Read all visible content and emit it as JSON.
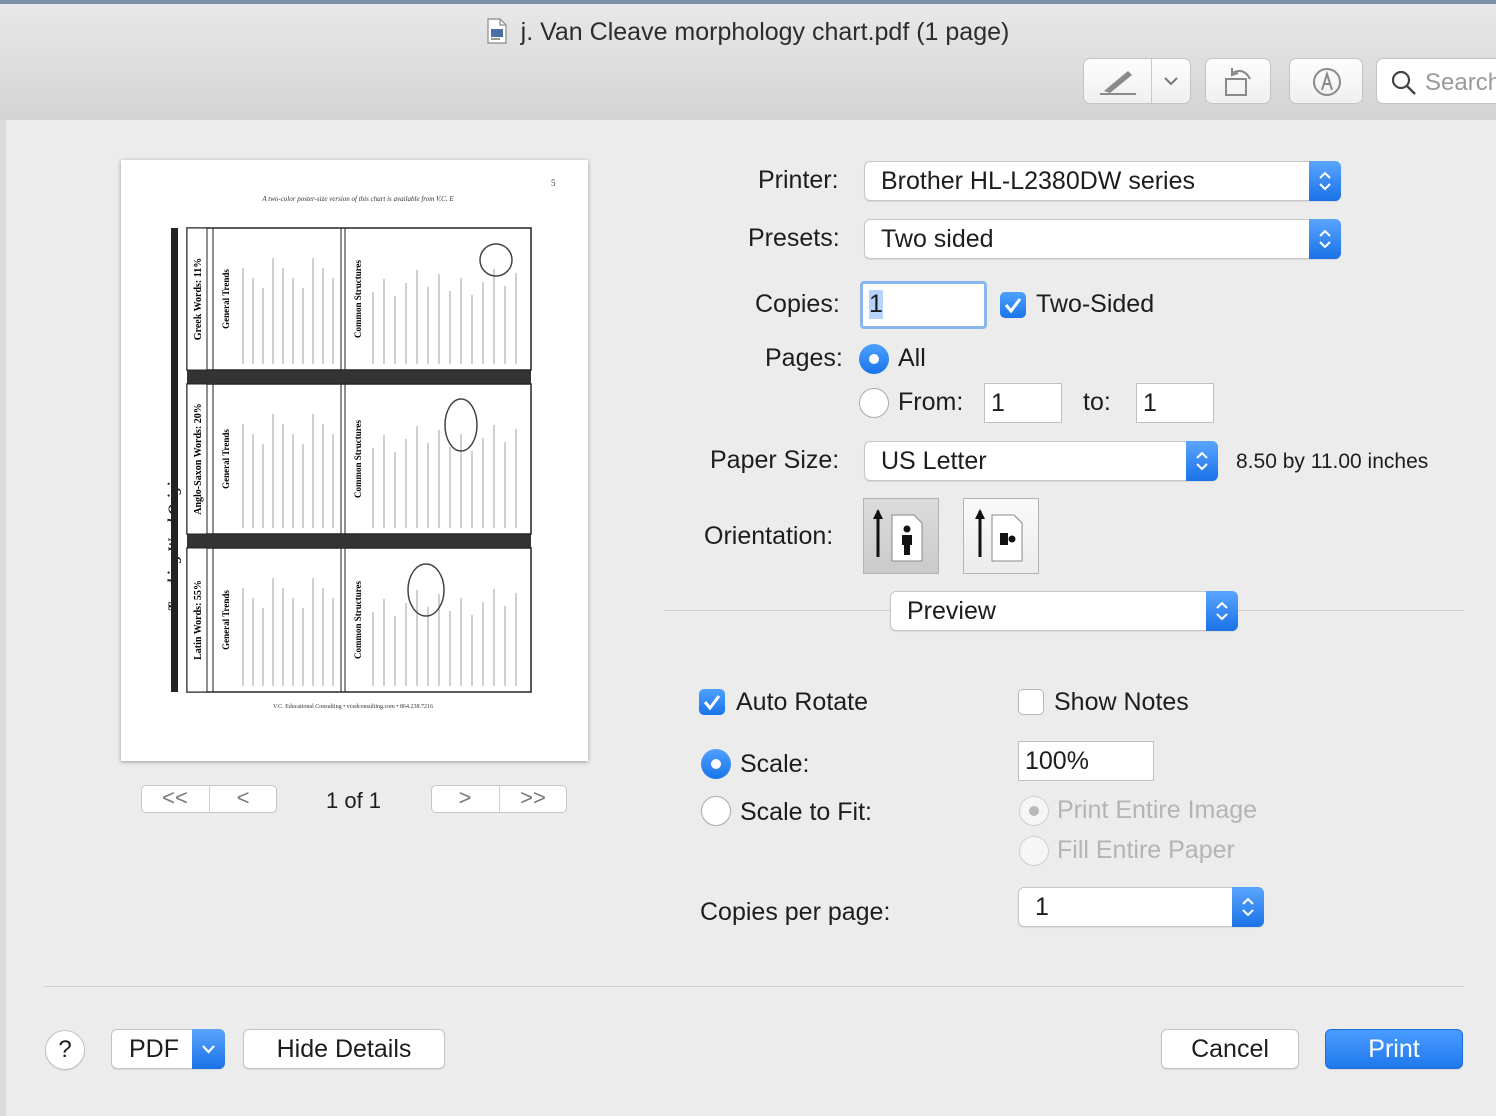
{
  "window": {
    "title": "j. Van Cleave morphology chart.pdf (1 page)"
  },
  "toolbar": {
    "search_placeholder": "Search",
    "icons": [
      "markup-pen-icon",
      "chevron-down-icon",
      "rotate-icon",
      "annotate-icon",
      "search-icon"
    ]
  },
  "preview": {
    "page_indicator": "1 of 1",
    "nav": {
      "first": "<<",
      "prev": "<",
      "next": ">",
      "last": ">>"
    },
    "document": {
      "header_note": "A two-color poster-size version of this chart is available from V.C. Educational Consulting. Please do NOT copy this chart except for personal reference.",
      "page_number": "5",
      "title": "Tracking Word Origins",
      "footer": "V.C. Educational Consulting • vcedconsulting.com • 864.238.7216",
      "columns": [
        {
          "heading": "Latin Words: 55%",
          "trends": "General Trends",
          "structures": "Common Structures"
        },
        {
          "heading": "Anglo-Saxon Words: 20%",
          "trends": "General Trends",
          "structures": "Common Structures"
        },
        {
          "heading": "Greek Words: 11%",
          "trends": "General Trends",
          "structures": "Common Structures"
        }
      ]
    }
  },
  "form": {
    "printer": {
      "label": "Printer:",
      "value": "Brother HL-L2380DW series"
    },
    "presets": {
      "label": "Presets:",
      "value": "Two sided"
    },
    "copies": {
      "label": "Copies:",
      "value": "1"
    },
    "two_sided": {
      "label": "Two-Sided",
      "checked": true
    },
    "pages": {
      "label": "Pages:",
      "all_label": "All",
      "from_label": "From:",
      "from_value": "1",
      "to_label": "to:",
      "to_value": "1",
      "selected": "All"
    },
    "paper_size": {
      "label": "Paper Size:",
      "value": "US Letter",
      "dimensions": "8.50 by 11.00 inches"
    },
    "orientation": {
      "label": "Orientation:",
      "selected": "portrait"
    },
    "section": {
      "value": "Preview"
    },
    "auto_rotate": {
      "label": "Auto Rotate",
      "checked": true
    },
    "show_notes": {
      "label": "Show Notes",
      "checked": false
    },
    "scale": {
      "label": "Scale:",
      "value": "100%",
      "selected": true
    },
    "scale_to_fit": {
      "label": "Scale to Fit:",
      "selected": false
    },
    "print_entire_image": {
      "label": "Print Entire Image"
    },
    "fill_entire_paper": {
      "label": "Fill Entire Paper"
    },
    "copies_per_page": {
      "label": "Copies per page:",
      "value": "1"
    }
  },
  "footer": {
    "help": "?",
    "pdf": "PDF",
    "hide_details": "Hide Details",
    "cancel": "Cancel",
    "print": "Print"
  },
  "colors": {
    "accent": "#1a74ea",
    "print_button": "#2f86f6"
  }
}
